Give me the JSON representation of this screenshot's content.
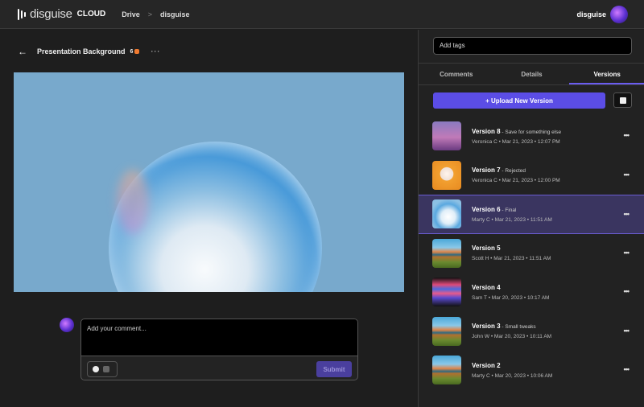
{
  "header": {
    "logo_word": "disguise",
    "logo_cloud": "CLOUD",
    "breadcrumbs": [
      "Drive",
      "disguise"
    ],
    "separator": ">",
    "user": "disguise"
  },
  "asset": {
    "title": "Presentation Background",
    "version_count": "6",
    "more": "···"
  },
  "comment": {
    "placeholder": "Add your comment...",
    "submit": "Submit"
  },
  "panel": {
    "tags_placeholder": "Add tags",
    "tabs": [
      {
        "label": "Comments",
        "active": false
      },
      {
        "label": "Details",
        "active": false
      },
      {
        "label": "Versions",
        "active": true
      }
    ],
    "upload_label": "+ Upload New Version"
  },
  "versions": [
    {
      "name": "Version 8",
      "note": " - Save for something else",
      "meta": "Veronica C  •  Mar 21, 2023  •  12:07 PM",
      "thumb": "sunset"
    },
    {
      "name": "Version 7",
      "note": " - Rejected",
      "meta": "Veronica C  •  Mar 21, 2023  •  12:00 PM",
      "thumb": "ghost"
    },
    {
      "name": "Version 6",
      "note": " - Final",
      "meta": "Marty C  •  Mar 21, 2023  •  11:51 AM",
      "thumb": "sphere",
      "selected": true
    },
    {
      "name": "Version 5",
      "note": "",
      "meta": "Scott H  •  Mar 21, 2023  •  11:51 AM",
      "thumb": "mountain"
    },
    {
      "name": "Version 4",
      "note": "",
      "meta": "Sam T  •  Mar 20, 2023  •  10:17 AM",
      "thumb": "lights"
    },
    {
      "name": "Version 3",
      "note": " - Small tweaks",
      "meta": "John W  •  Mar 20, 2023  •  10:11 AM",
      "thumb": "mountain"
    },
    {
      "name": "Version 2",
      "note": "",
      "meta": "Marty C  •  Mar 20, 2023  •  10:06 AM",
      "thumb": "mountain"
    }
  ],
  "colors": {
    "accent": "#5b4de6",
    "selected_row": "#3a3560",
    "badge": "#f07a30"
  }
}
